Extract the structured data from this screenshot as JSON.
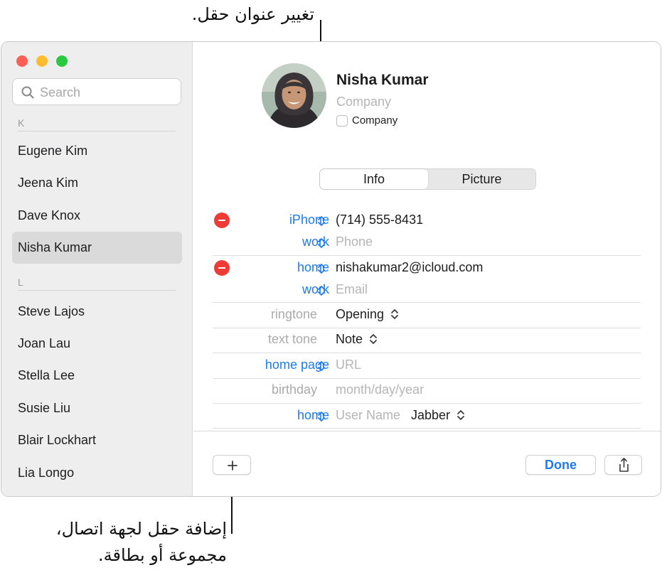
{
  "callouts": {
    "top": "تغيير عنوان حقل.",
    "bottom_line1": "إضافة حقل لجهة اتصال،",
    "bottom_line2": "مجموعة أو بطاقة."
  },
  "search": {
    "placeholder": "Search"
  },
  "sidebar": {
    "sections": [
      {
        "letter": "K",
        "contacts": [
          "Eugene Kim",
          "Jeena Kim",
          "Dave Knox",
          "Nisha Kumar"
        ]
      },
      {
        "letter": "L",
        "contacts": [
          "Steve Lajos",
          "Joan Lau",
          "Stella Lee",
          "Susie Liu",
          "Blair Lockhart",
          "Lia Longo"
        ]
      }
    ],
    "selected": "Nisha Kumar"
  },
  "card": {
    "name": "Nisha  Kumar",
    "company_placeholder": "Company",
    "company_checkbox_label": "Company",
    "company_checked": false
  },
  "tabs": {
    "info": "Info",
    "picture": "Picture",
    "selected": "Info"
  },
  "fields": {
    "phone1": {
      "label": "iPhone",
      "value": "(714) 555-8431"
    },
    "phone2": {
      "label": "work",
      "placeholder": "Phone"
    },
    "email1": {
      "label": "home",
      "value": "nishakumar2@icloud.com"
    },
    "email2": {
      "label": "work",
      "placeholder": "Email"
    },
    "ringtone": {
      "label": "ringtone",
      "value": "Opening"
    },
    "texttone": {
      "label": "text tone",
      "value": "Note"
    },
    "homepage": {
      "label": "home page",
      "placeholder": "URL"
    },
    "birthday": {
      "label": "birthday",
      "placeholder": "month/day/year"
    },
    "im": {
      "label": "home",
      "placeholder": "User Name",
      "service": "Jabber"
    }
  },
  "buttons": {
    "done": "Done"
  },
  "colors": {
    "accent": "#1c7bf0",
    "remove": "#ee3b35",
    "close": "#ff5f57",
    "minimize": "#febc2e",
    "maximize": "#28c840"
  },
  "icons": {
    "search": "magnifying-glass",
    "stepper": "up-down-chevrons",
    "remove": "minus-circle",
    "add": "plus",
    "share": "square-and-arrow-up"
  }
}
